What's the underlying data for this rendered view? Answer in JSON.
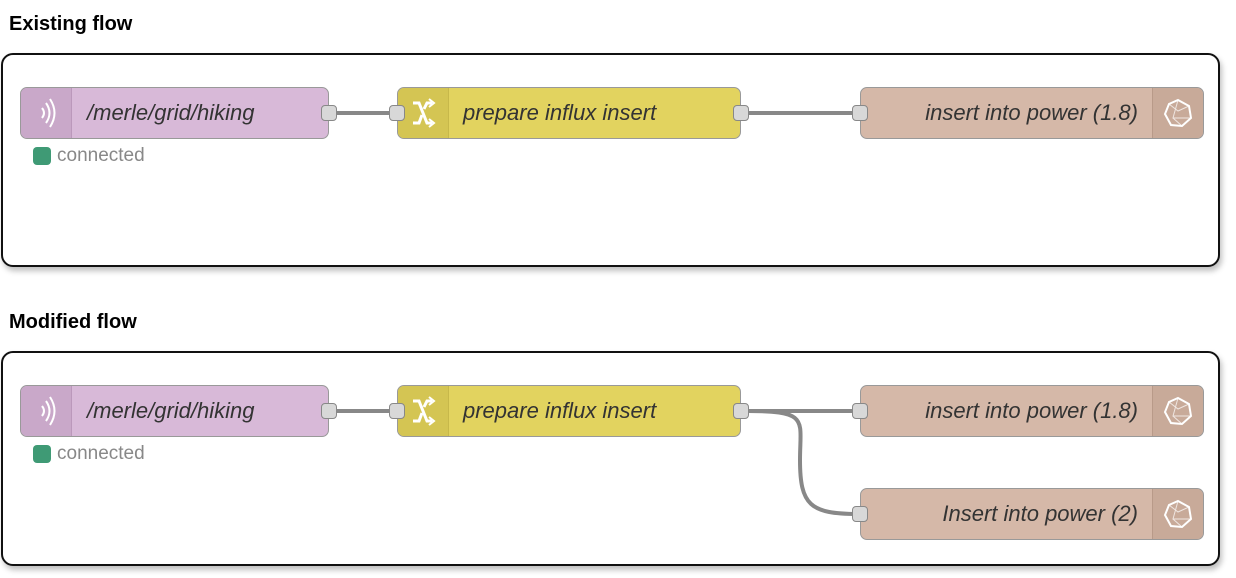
{
  "sections": [
    {
      "title": "Existing flow",
      "nodes": {
        "mqtt": {
          "label": "/merle/grid/hiking",
          "icon": "radio-waves-icon",
          "status": "connected"
        },
        "function": {
          "label": "prepare influx insert",
          "icon": "shuffle-icon"
        },
        "influx_1": {
          "label": "insert into power (1.8)",
          "icon": "influxdb-icon"
        }
      }
    },
    {
      "title": "Modified flow",
      "nodes": {
        "mqtt": {
          "label": "/merle/grid/hiking",
          "icon": "radio-waves-icon",
          "status": "connected"
        },
        "function": {
          "label": "prepare influx insert",
          "icon": "shuffle-icon"
        },
        "influx_1": {
          "label": "insert into power (1.8)",
          "icon": "influxdb-icon"
        },
        "influx_2": {
          "label": "Insert into power (2)",
          "icon": "influxdb-icon"
        }
      }
    }
  ],
  "colors": {
    "mqtt_node": "#d8b9d8",
    "function_node": "#e2d35f",
    "influx_node": "#d5b8a8",
    "status_connected": "#3f9a75",
    "wire": "#888888"
  }
}
